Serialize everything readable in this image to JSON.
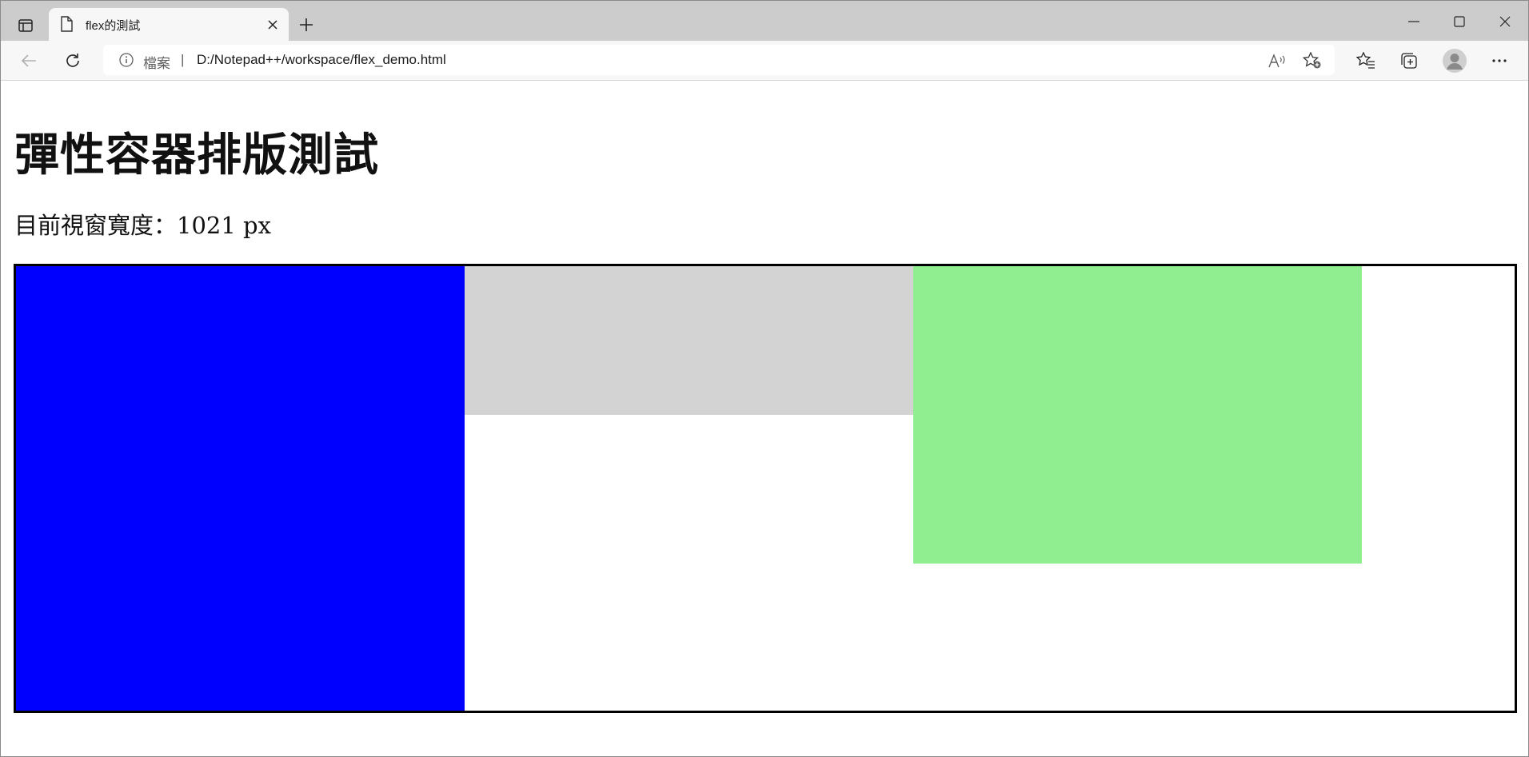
{
  "browser": {
    "tab_title": "flex的測試",
    "address": {
      "scheme_label": "檔案",
      "separator": "|",
      "url": "D:/Notepad++/workspace/flex_demo.html"
    },
    "read_aloud_label": "A",
    "icons": [
      "sidebar-icon",
      "page-icon",
      "close-icon",
      "plus-icon",
      "minimize-icon",
      "maximize-icon",
      "window-close-icon",
      "back-icon",
      "reload-icon",
      "info-icon",
      "read-aloud-icon",
      "add-favorite-icon",
      "favorites-icon",
      "collections-icon",
      "avatar-icon",
      "more-icon"
    ]
  },
  "page": {
    "title": "彈性容器排版測試",
    "viewport_width_text": "目前視窗寬度：1021 px",
    "flex_items": [
      {
        "name": "blue-box",
        "color": "#0000ff"
      },
      {
        "name": "gray-box",
        "color": "#d3d3d3"
      },
      {
        "name": "green-box",
        "color": "#90ee90"
      }
    ],
    "container_border_color": "#000000"
  }
}
